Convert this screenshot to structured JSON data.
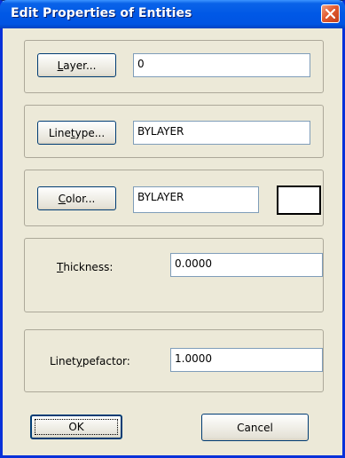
{
  "window": {
    "title": "Edit Properties of Entities"
  },
  "layer": {
    "button_prefix": "",
    "button_underline": "L",
    "button_rest": "ayer...",
    "value": "0"
  },
  "linetype": {
    "button_prefix": "Line",
    "button_underline": "t",
    "button_rest": "ype...",
    "value": "BYLAYER"
  },
  "color": {
    "button_prefix": "",
    "button_underline": "C",
    "button_rest": "olor...",
    "value": "BYLAYER",
    "swatch_color": "#ffffff"
  },
  "thickness": {
    "label_prefix": "",
    "label_underline": "T",
    "label_rest": "hickness:",
    "value": "0.0000"
  },
  "linetypefactor": {
    "label_prefix": "Linet",
    "label_underline": "y",
    "label_rest": "pefactor:",
    "value": "1.0000"
  },
  "buttons": {
    "ok_label": "OK",
    "cancel_label": "Cancel"
  },
  "icons": {
    "close": "close-icon"
  }
}
